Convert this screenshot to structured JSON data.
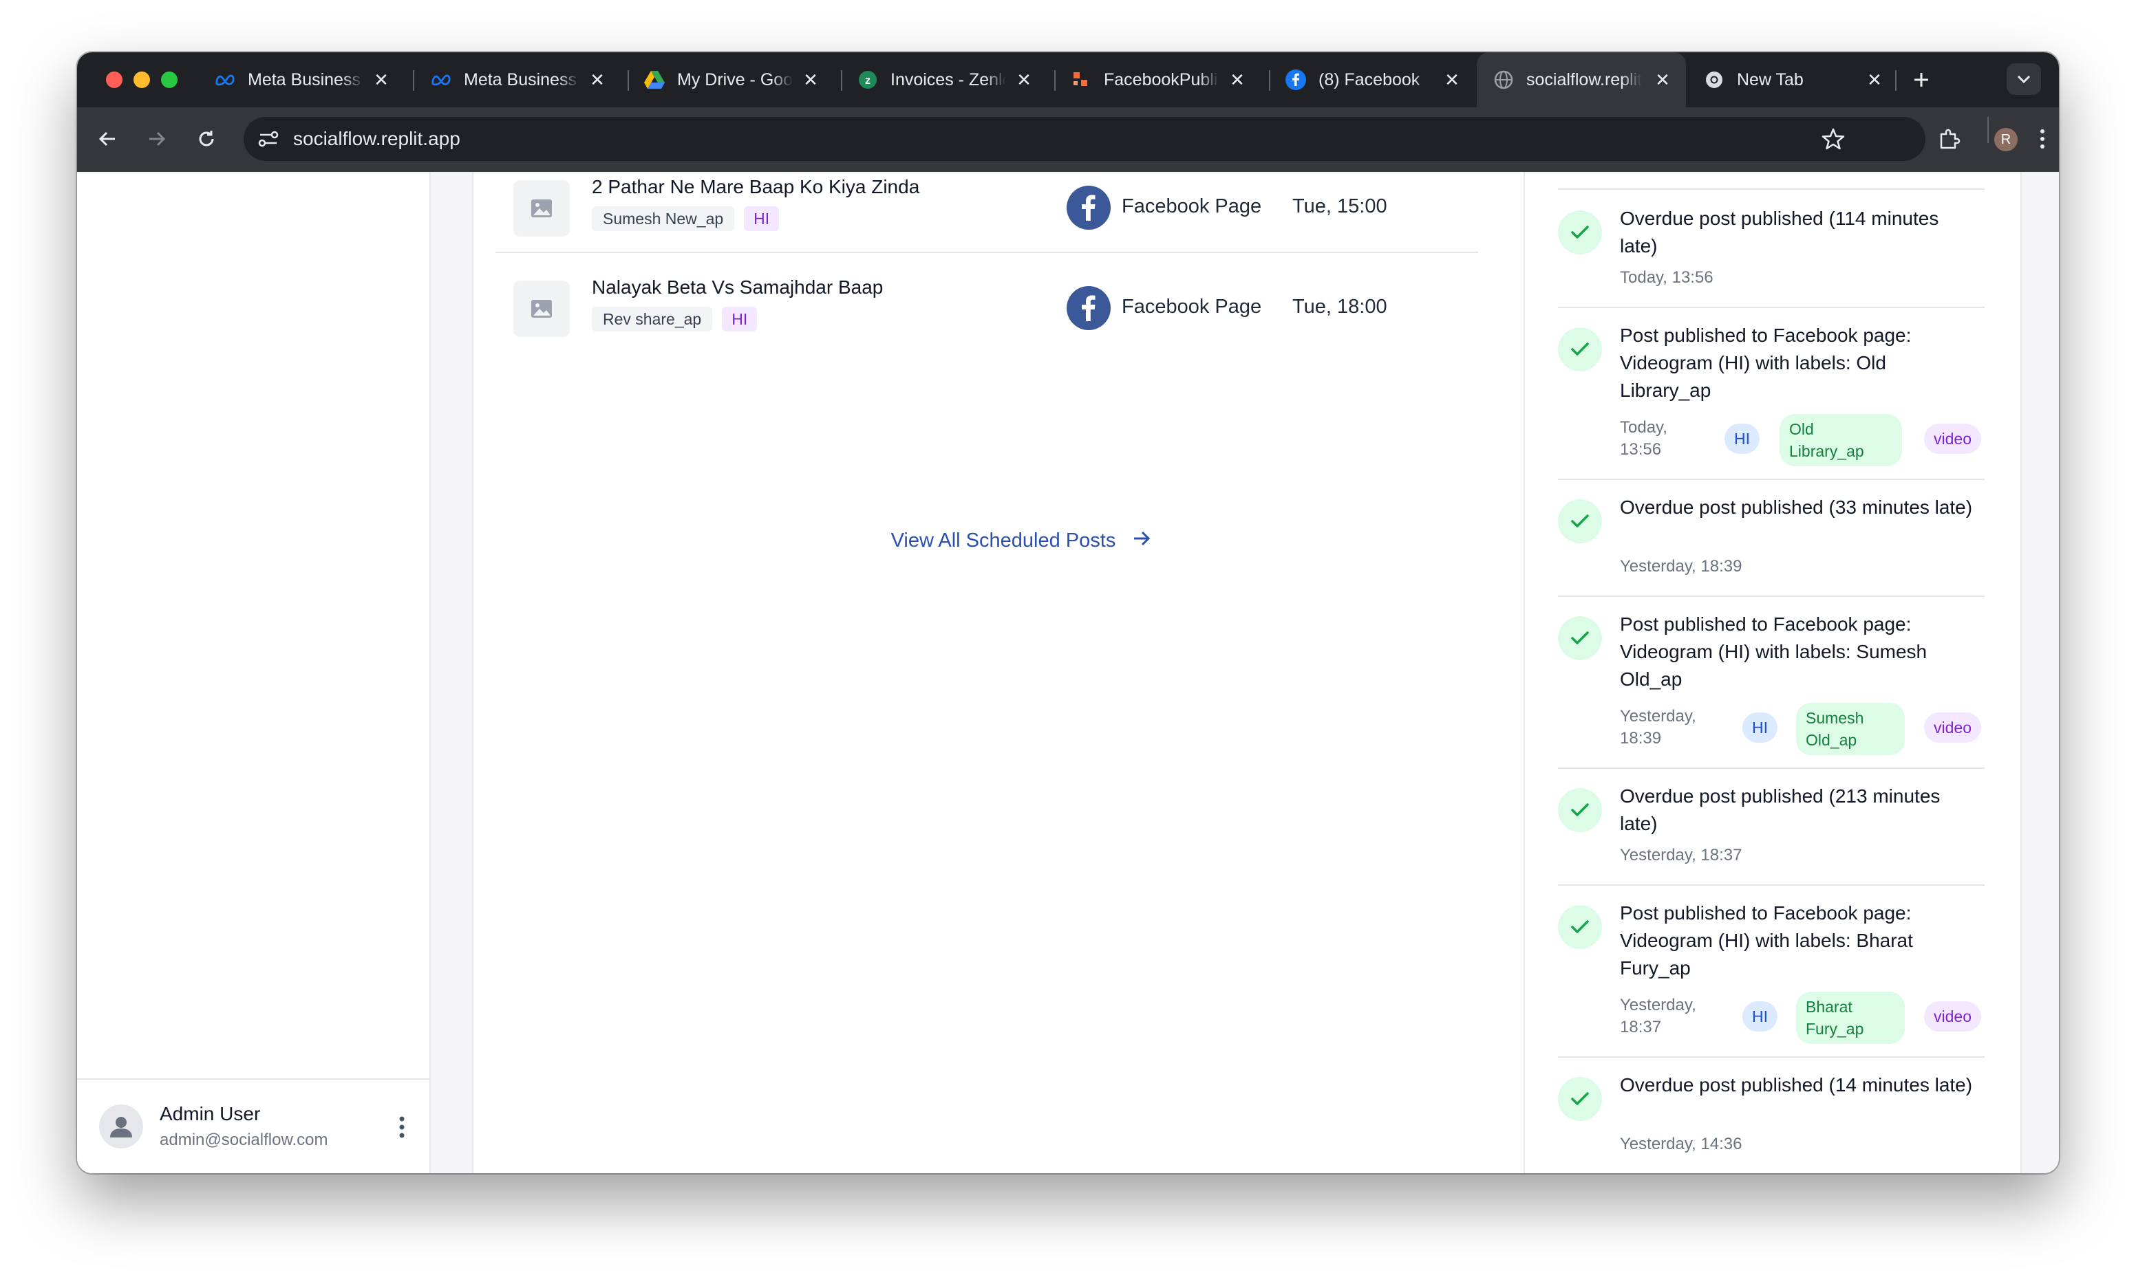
{
  "browser": {
    "tabs": [
      {
        "title": "Meta Business Suite",
        "icon": "meta-icon"
      },
      {
        "title": "Meta Business Suite",
        "icon": "meta-icon"
      },
      {
        "title": "My Drive - Google Drive",
        "icon": "google-drive-icon"
      },
      {
        "title": "Invoices - Zenlo",
        "icon": "zen-icon"
      },
      {
        "title": "FacebookPublisher",
        "icon": "app-icon"
      },
      {
        "title": "(8) Facebook",
        "icon": "facebook-icon"
      },
      {
        "title": "socialflow.replit.app",
        "icon": "globe-icon"
      },
      {
        "title": "New Tab",
        "icon": "chrome-icon"
      }
    ],
    "active_tab_index": 6,
    "url": "socialflow.replit.app",
    "profile_initial": "R"
  },
  "user": {
    "name": "Admin User",
    "email": "admin@socialflow.com"
  },
  "scheduled_posts": [
    {
      "title": "2 Pathar Ne Mare Baap Ko Kiya Zinda",
      "label": "Sumesh New_ap",
      "language": "HI",
      "platform": "Facebook Page",
      "time": "Tue, 15:00"
    },
    {
      "title": "Nalayak Beta Vs Samajhdar Baap",
      "label": "Rev share_ap",
      "language": "HI",
      "platform": "Facebook Page",
      "time": "Tue, 18:00"
    }
  ],
  "view_all_label": "View All Scheduled Posts",
  "activity": [
    {
      "text": "Overdue post published (114 minutes late)",
      "time": "Today, 13:56"
    },
    {
      "text": "Post published to Facebook page: Videogram (HI) with labels: Old Library_ap",
      "time": "Today, 13:56",
      "chips": [
        "HI",
        "Old Library_ap",
        "video"
      ]
    },
    {
      "text": "Overdue post published (33 minutes late)",
      "time": "Yesterday, 18:39"
    },
    {
      "text": "Post published to Facebook page: Videogram (HI) with labels: Sumesh Old_ap",
      "time": "Yesterday, 18:39",
      "chips": [
        "HI",
        "Sumesh Old_ap",
        "video"
      ]
    },
    {
      "text": "Overdue post published (213 minutes late)",
      "time": "Yesterday, 18:37"
    },
    {
      "text": "Post published to Facebook page: Videogram (HI) with labels: Bharat Fury_ap",
      "time": "Yesterday, 18:37",
      "chips": [
        "HI",
        "Bharat Fury_ap",
        "video"
      ]
    },
    {
      "text": "Overdue post published (14 minutes late)",
      "time": "Yesterday, 14:36"
    }
  ],
  "colors": {
    "facebook_blue": "#3b5998",
    "success_green": "#16a34a",
    "link_blue": "#2b4fae"
  }
}
